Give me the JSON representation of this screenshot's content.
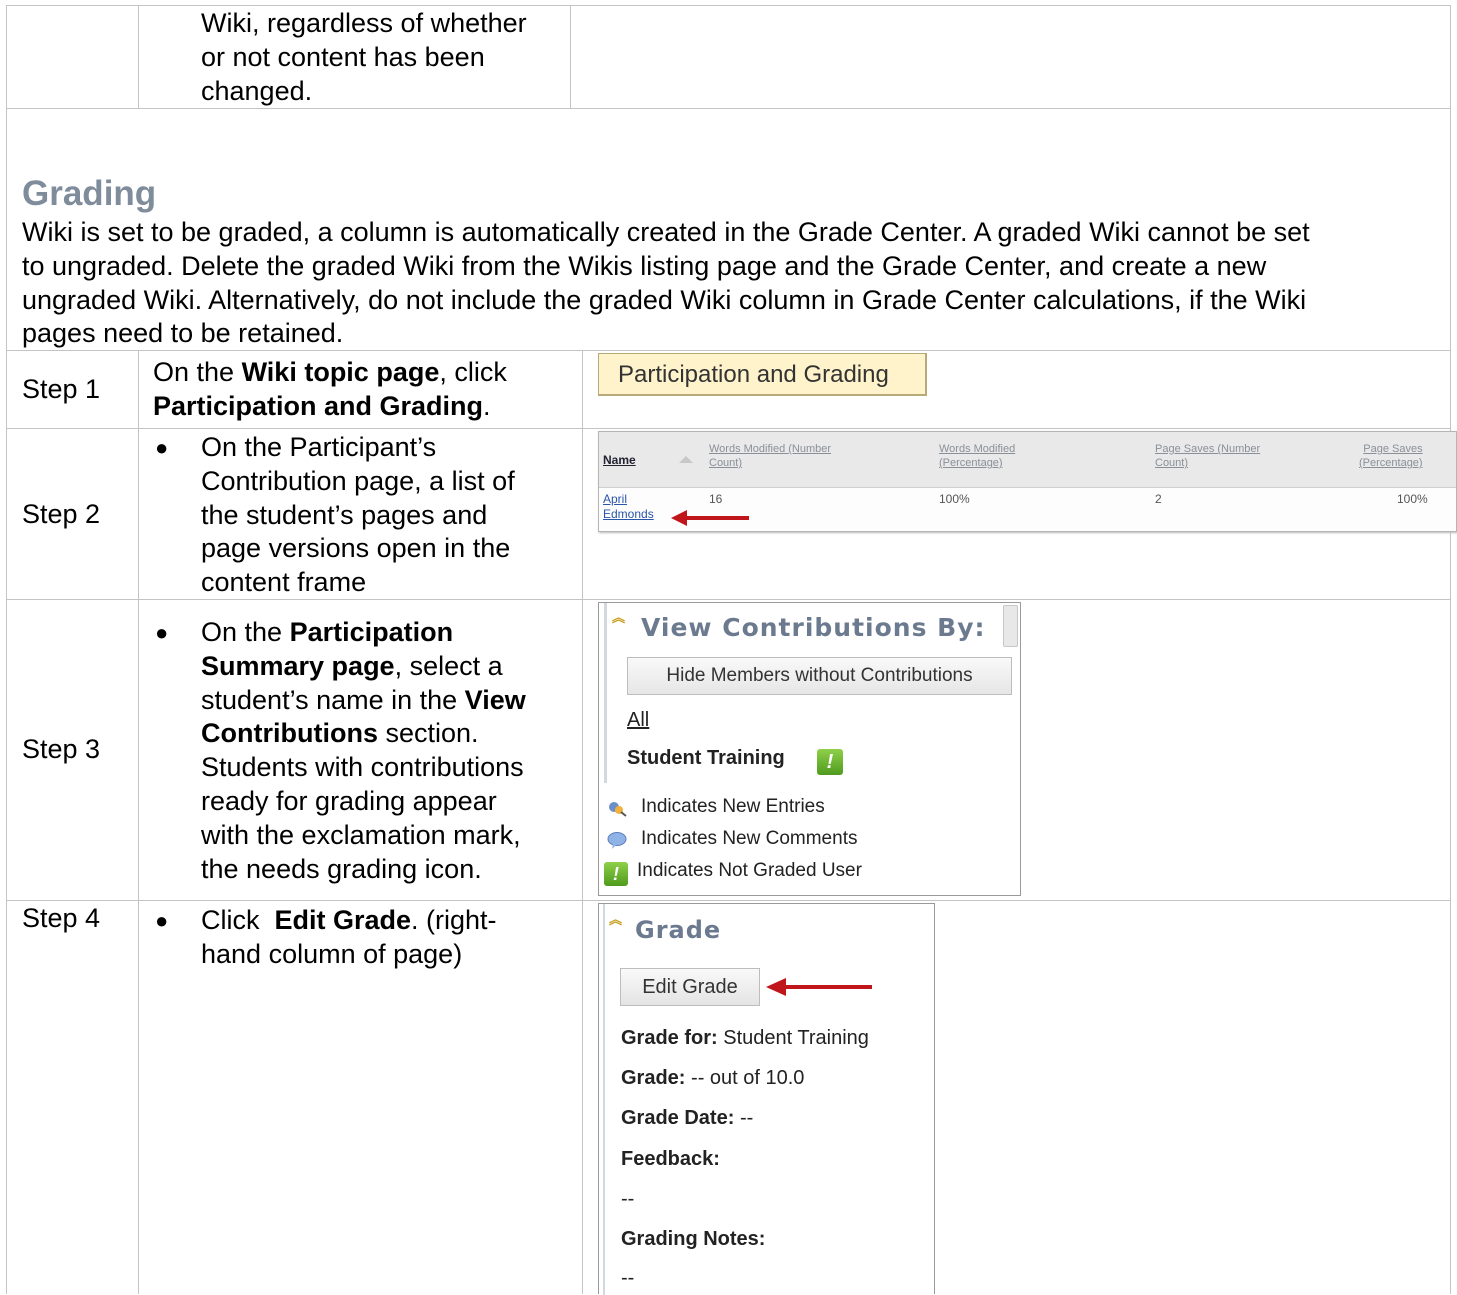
{
  "top_row": {
    "lines": [
      "Wiki, regardless of whether",
      "or not content has been",
      "changed."
    ]
  },
  "section": {
    "heading": "Grading",
    "intro_lines": [
      "Wiki is set to be graded, a column is automatically created in the Grade Center. A graded Wiki cannot be set",
      "to ungraded. Delete the graded Wiki from the Wikis listing page and the Grade Center, and create a new",
      "ungraded Wiki. Alternatively, do not include the graded Wiki column in Grade Center calculations, if the Wiki",
      "pages need to be retained."
    ]
  },
  "steps": [
    {
      "label": "Step 1",
      "lines": [
        {
          "pre": "On the ",
          "bold": "Wiki topic page",
          "post": ", click"
        },
        {
          "pre": "",
          "bold": "Participation and Grading",
          "post": "."
        }
      ],
      "button": "Participation and Grading"
    },
    {
      "label": "Step 2",
      "lines": [
        "On the Participant’s",
        "Contribution page, a list of",
        "the student’s pages and",
        "page versions open in the",
        "content frame"
      ],
      "table": {
        "headers": [
          "Name",
          "Words Modified (Number Count)",
          "Words Modified (Percentage)",
          "Page Saves (Number Count)",
          "Page Saves (Percentage)"
        ],
        "header_lines": [
          [
            "Name"
          ],
          [
            "Words Modified (Number",
            "Count)"
          ],
          [
            "Words Modified",
            "(Percentage)"
          ],
          [
            "Page Saves (Number",
            "Count)"
          ],
          [
            "Page Saves",
            "(Percentage)"
          ]
        ],
        "row": {
          "name_first": "April",
          "name_last": "Edmonds",
          "words_count": "16",
          "words_pct": "100%",
          "saves_count": "2",
          "saves_pct": "100%"
        }
      }
    },
    {
      "label": "Step 3",
      "lines": [
        [
          {
            "t": "On the ",
            "b": false
          },
          {
            "t": "Participation",
            "b": true
          }
        ],
        [
          {
            "t": "Summary page",
            "b": true
          },
          {
            "t": ", select a",
            "b": false
          }
        ],
        [
          {
            "t": "student’s name in the ",
            "b": false
          },
          {
            "t": "View",
            "b": true
          }
        ],
        [
          {
            "t": "Contributions",
            "b": true
          },
          {
            "t": " section.",
            "b": false
          }
        ],
        [
          {
            "t": "Students with contributions",
            "b": false
          }
        ],
        [
          {
            "t": "ready for grading appear",
            "b": false
          }
        ],
        [
          {
            "t": "with the exclamation mark,",
            "b": false
          }
        ],
        [
          {
            "t": "the needs grading icon.",
            "b": false
          }
        ]
      ],
      "panel": {
        "title": "View Contributions By:",
        "hide_button": "Hide Members without Contributions",
        "all_link": "All",
        "student": "Student Training",
        "legend": [
          "Indicates New Entries",
          "Indicates New Comments",
          "Indicates Not Graded User"
        ]
      }
    },
    {
      "label": "Step 4",
      "lines": [
        [
          {
            "t": "Click  ",
            "b": false
          },
          {
            "t": "Edit Grade",
            "b": true
          },
          {
            "t": ". (right-",
            "b": false
          }
        ],
        [
          {
            "t": "hand column of page)",
            "b": false
          }
        ]
      ],
      "panel": {
        "title": "Grade",
        "edit_button": "Edit Grade",
        "grade_for_label": "Grade for:",
        "grade_for_value": "Student Training",
        "grade_label": "Grade:",
        "grade_value": "-- out of 10.0",
        "grade_date_label": "Grade Date:",
        "grade_date_value": "--",
        "feedback_label": "Feedback:",
        "feedback_value": "--",
        "notes_label": "Grading Notes:",
        "notes_value": "--"
      }
    }
  ],
  "colors": {
    "heading": "#7f8c9b",
    "rule": "#c4c4c4",
    "step1_button_bg": "#fff3cb",
    "arrow": "#c0161b",
    "needs_grading_icon": "#5aa825"
  }
}
